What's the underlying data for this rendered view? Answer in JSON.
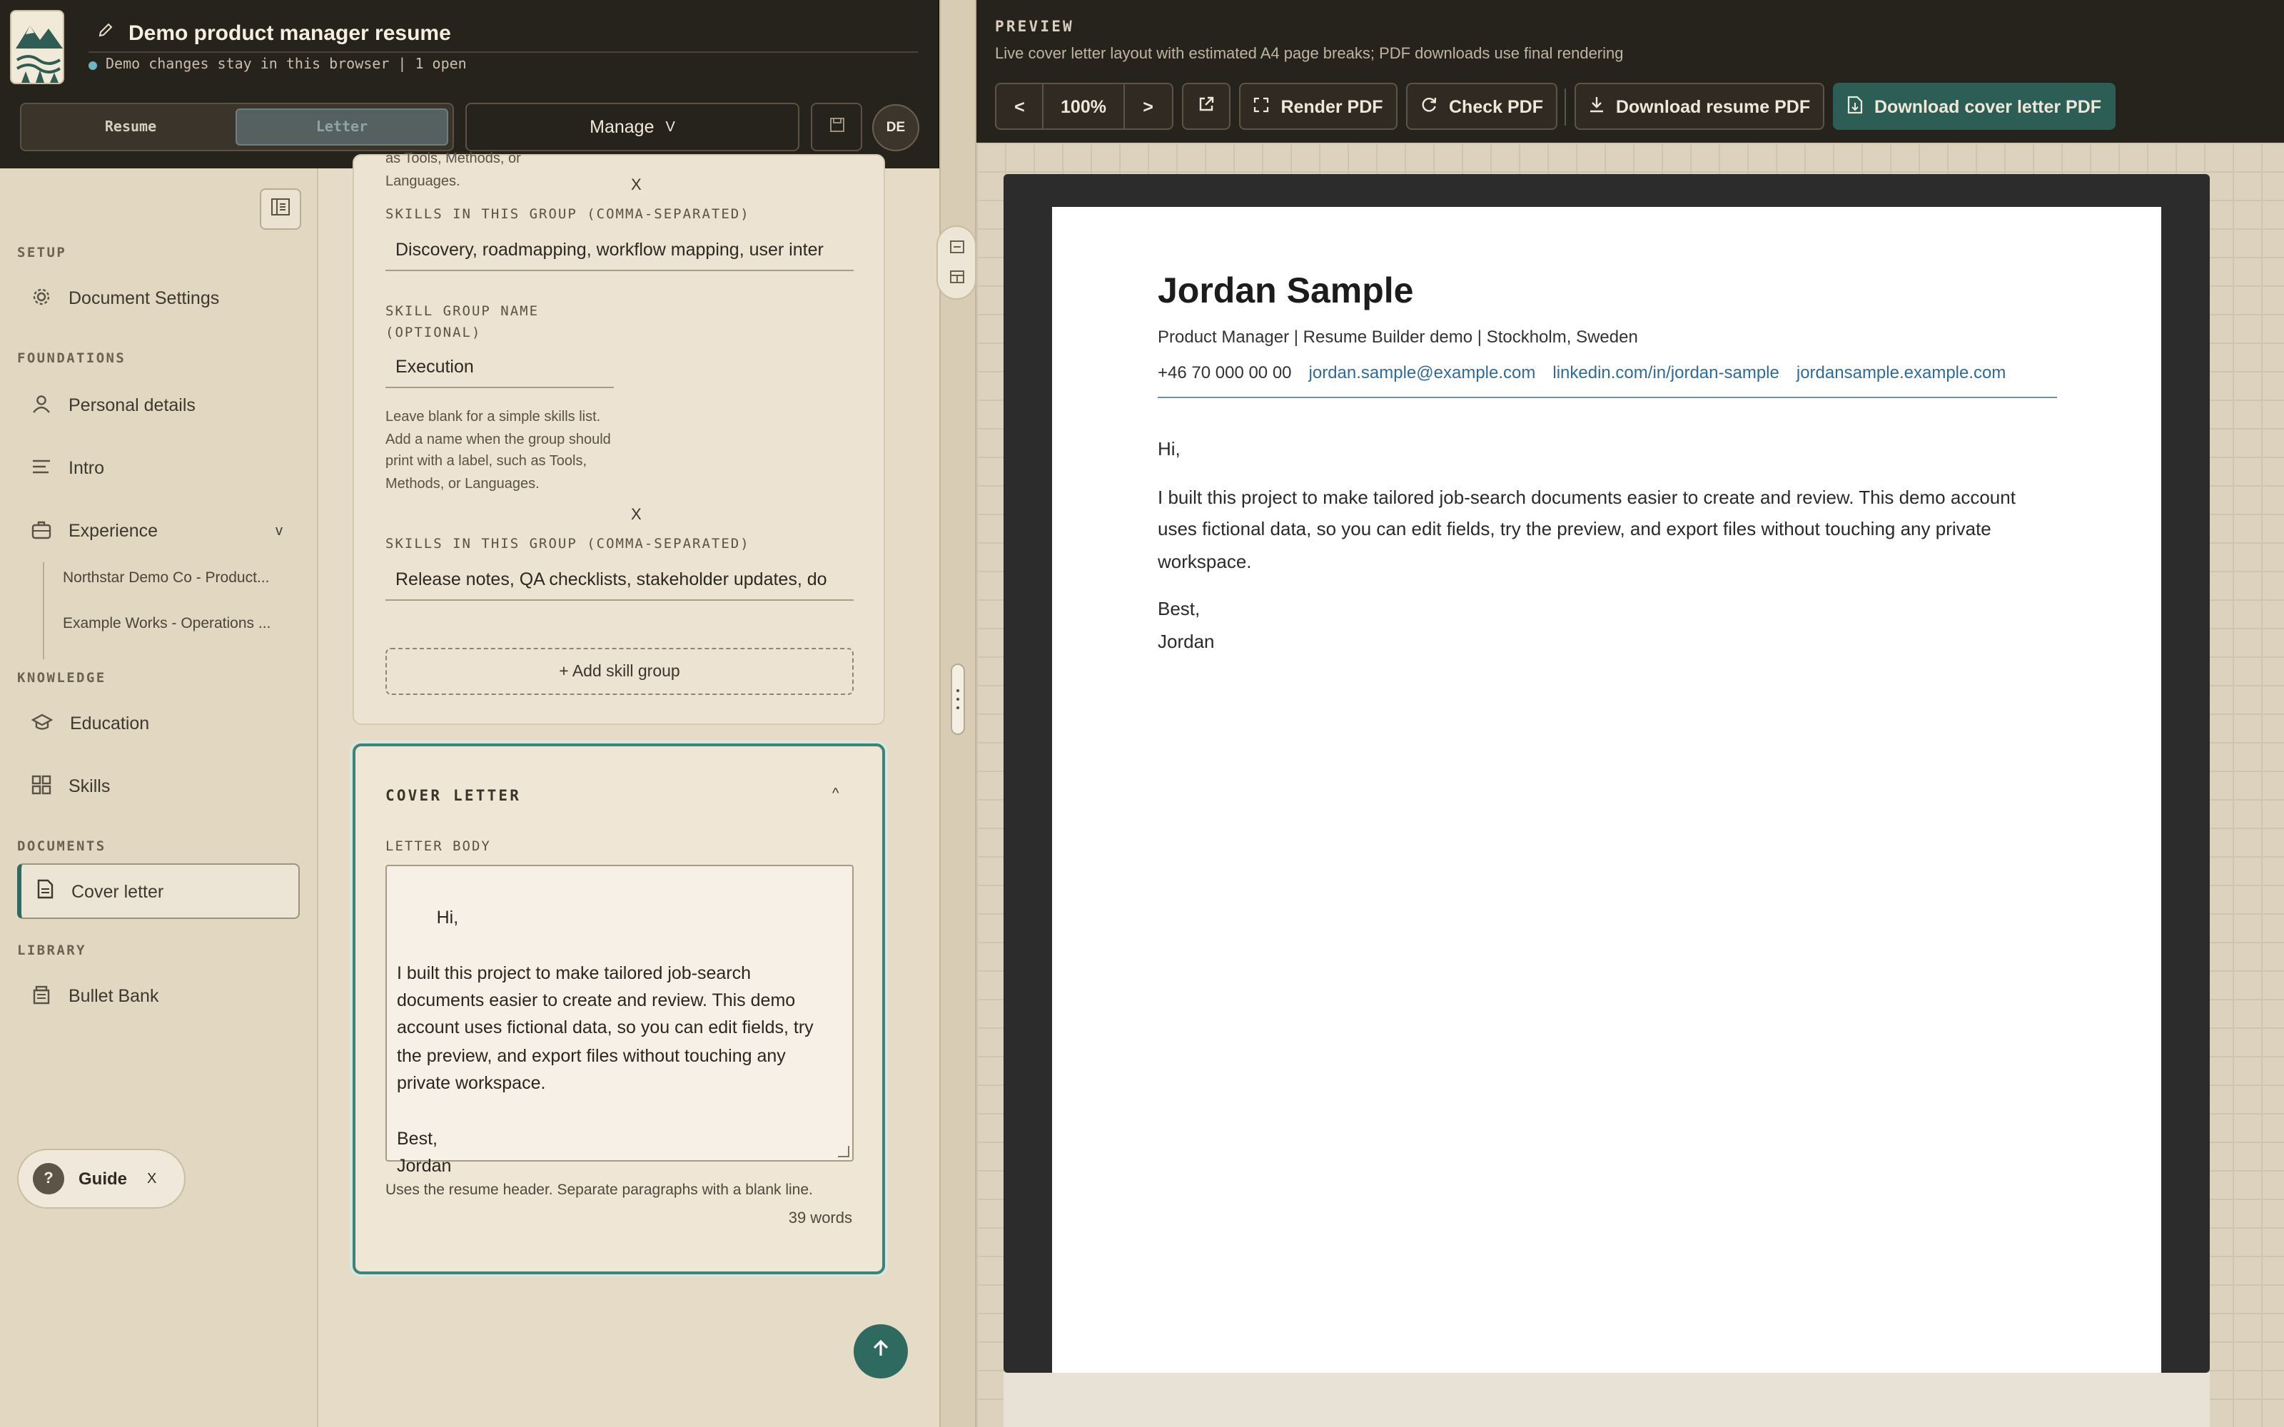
{
  "header": {
    "doc_title": "Demo product manager resume",
    "status": "Demo changes stay in this browser | 1 open",
    "tabs": [
      "Resume",
      "Letter"
    ],
    "manage_label": "Manage",
    "manage_chevron": "V",
    "avatar_initials": "DE"
  },
  "sidebar": {
    "sections": {
      "setup": "SETUP",
      "foundations": "FOUNDATIONS",
      "knowledge": "KNOWLEDGE",
      "documents": "DOCUMENTS",
      "library": "LIBRARY"
    },
    "items": {
      "document_settings": "Document Settings",
      "personal_details": "Personal details",
      "intro": "Intro",
      "experience": "Experience",
      "experience_chevron": "v",
      "education": "Education",
      "skills": "Skills",
      "cover_letter": "Cover letter",
      "bullet_bank": "Bullet Bank"
    },
    "experience_sub": [
      "Northstar Demo Co - Product...",
      "Example Works - Operations ..."
    ],
    "guide_label": "Guide",
    "guide_close": "X",
    "guide_q": "?"
  },
  "skills_card": {
    "top_help_fragment": "as Tools, Methods, or\nLanguages.",
    "remove_label": "X",
    "skills_label": "SKILLS IN THIS GROUP (COMMA-SEPARATED)",
    "skills_value_1": "Discovery, roadmapping, workflow mapping, user inter",
    "group_name_label": "SKILL GROUP NAME\n(OPTIONAL)",
    "group_name_value": "Execution",
    "group_help": "Leave blank for a simple skills list. Add a name when the group should print with a label, such as Tools, Methods, or Languages.",
    "skills_value_2": "Release notes, QA checklists, stakeholder updates, do",
    "add_skill_group": "+ Add skill group"
  },
  "cover_card": {
    "title": "COVER LETTER",
    "chevron": "^",
    "body_label": "LETTER BODY",
    "body": "Hi,\n\nI built this project to make tailored job-search documents easier to create and review. This demo account uses fictional data, so you can edit fields, try the preview, and export files without touching any private workspace.\n\nBest,\nJordan",
    "help": "Uses the resume header. Separate paragraphs with a blank line.",
    "word_count": "39 words"
  },
  "preview": {
    "eyebrow": "PREVIEW",
    "subtitle": "Live cover letter layout with estimated A4 page breaks; PDF downloads use final rendering",
    "prev": "<",
    "zoom": "100%",
    "next": ">",
    "render_pdf": "Render PDF",
    "check_pdf": "Check PDF",
    "download_resume": "Download resume PDF",
    "download_letter": "Download cover letter PDF"
  },
  "letter": {
    "name": "Jordan Sample",
    "meta": "Product Manager | Resume Builder demo | Stockholm, Sweden",
    "phone": "+46 70 000 00 00",
    "email": "jordan.sample@example.com",
    "linkedin": "linkedin.com/in/jordan-sample",
    "website": "jordansample.example.com",
    "greeting": "Hi,",
    "paragraph": "I built this project to make tailored job-search documents easier to create and review. This demo account uses fictional data, so you can edit fields, try the preview, and export files without touching any private workspace.",
    "closing": "Best,",
    "signature": "Jordan"
  },
  "colors": {
    "accent": "#2f6a60",
    "topbar": "#26221c",
    "sidebar": "#e2d7c1",
    "link": "#2e6b9a"
  }
}
